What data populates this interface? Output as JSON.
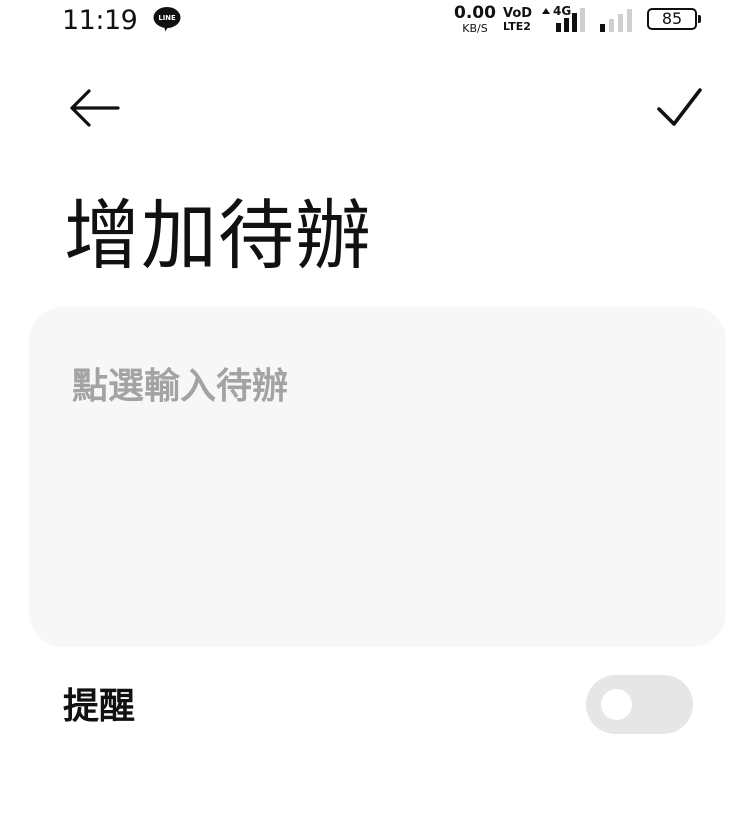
{
  "status_bar": {
    "time": "11:19",
    "net_speed_value": "0.00",
    "net_speed_unit": "KB/S",
    "volte_top": "VoD",
    "volte_bottom": "LTE2",
    "network_type": "4G",
    "battery_level": "85",
    "app_notification_icon": "line-app-icon"
  },
  "toolbar": {
    "back_icon": "arrow-left-icon",
    "confirm_icon": "checkmark-icon"
  },
  "page": {
    "title": "增加待辦"
  },
  "todo_input": {
    "placeholder": "點選輸入待辦",
    "value": ""
  },
  "reminder": {
    "label": "提醒",
    "enabled": false
  },
  "colors": {
    "card_background": "#f7f7f7",
    "placeholder_text": "#a3a3a3",
    "toggle_off_track": "#e6e6e6"
  }
}
